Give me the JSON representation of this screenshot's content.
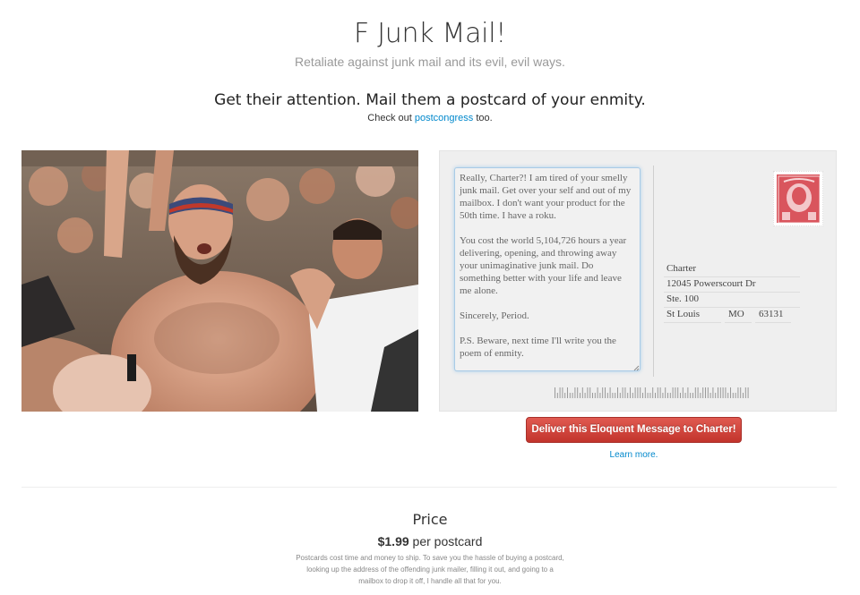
{
  "header": {
    "title": "F Junk Mail!",
    "subtitle": "Retaliate against junk mail and its evil, evil ways.",
    "tagline": "Get their attention. Mail them a postcard of your enmity.",
    "checkout_prefix": "Check out ",
    "checkout_link": "postcongress",
    "checkout_suffix": " too."
  },
  "postcard": {
    "message": "Really, Charter?! I am tired of your smelly junk mail. Get over your self and out of my mailbox. I don't want your product for the 50th time. I have a roku.\n\nYou cost the world 5,104,726 hours a year delivering, opening, and throwing away your unimaginative junk mail. Do something better with your life and leave me alone.\n\nSincerely, Period.\n\nP.S. Beware, next time I'll write you the poem of enmity.",
    "address": {
      "name": "Charter",
      "street": "12045 Powerscourt Dr",
      "unit": "Ste. 100",
      "city": "St Louis",
      "state": "MO",
      "zip": "63131"
    }
  },
  "actions": {
    "deliver_label": "Deliver this Eloquent Message to Charter!",
    "learn_more": "Learn more."
  },
  "price": {
    "heading": "Price",
    "amount": "$1.99",
    "unit": " per postcard",
    "description": "Postcards cost time and money to ship. To save you the hassle of buying a postcard, looking up the address of the offending junk mailer, filling it out, and going to a mailbox to drop it off, I handle all that for you."
  },
  "colors": {
    "accent": "#0088cc",
    "button": "#d1443b",
    "stamp": "#d9555d"
  }
}
